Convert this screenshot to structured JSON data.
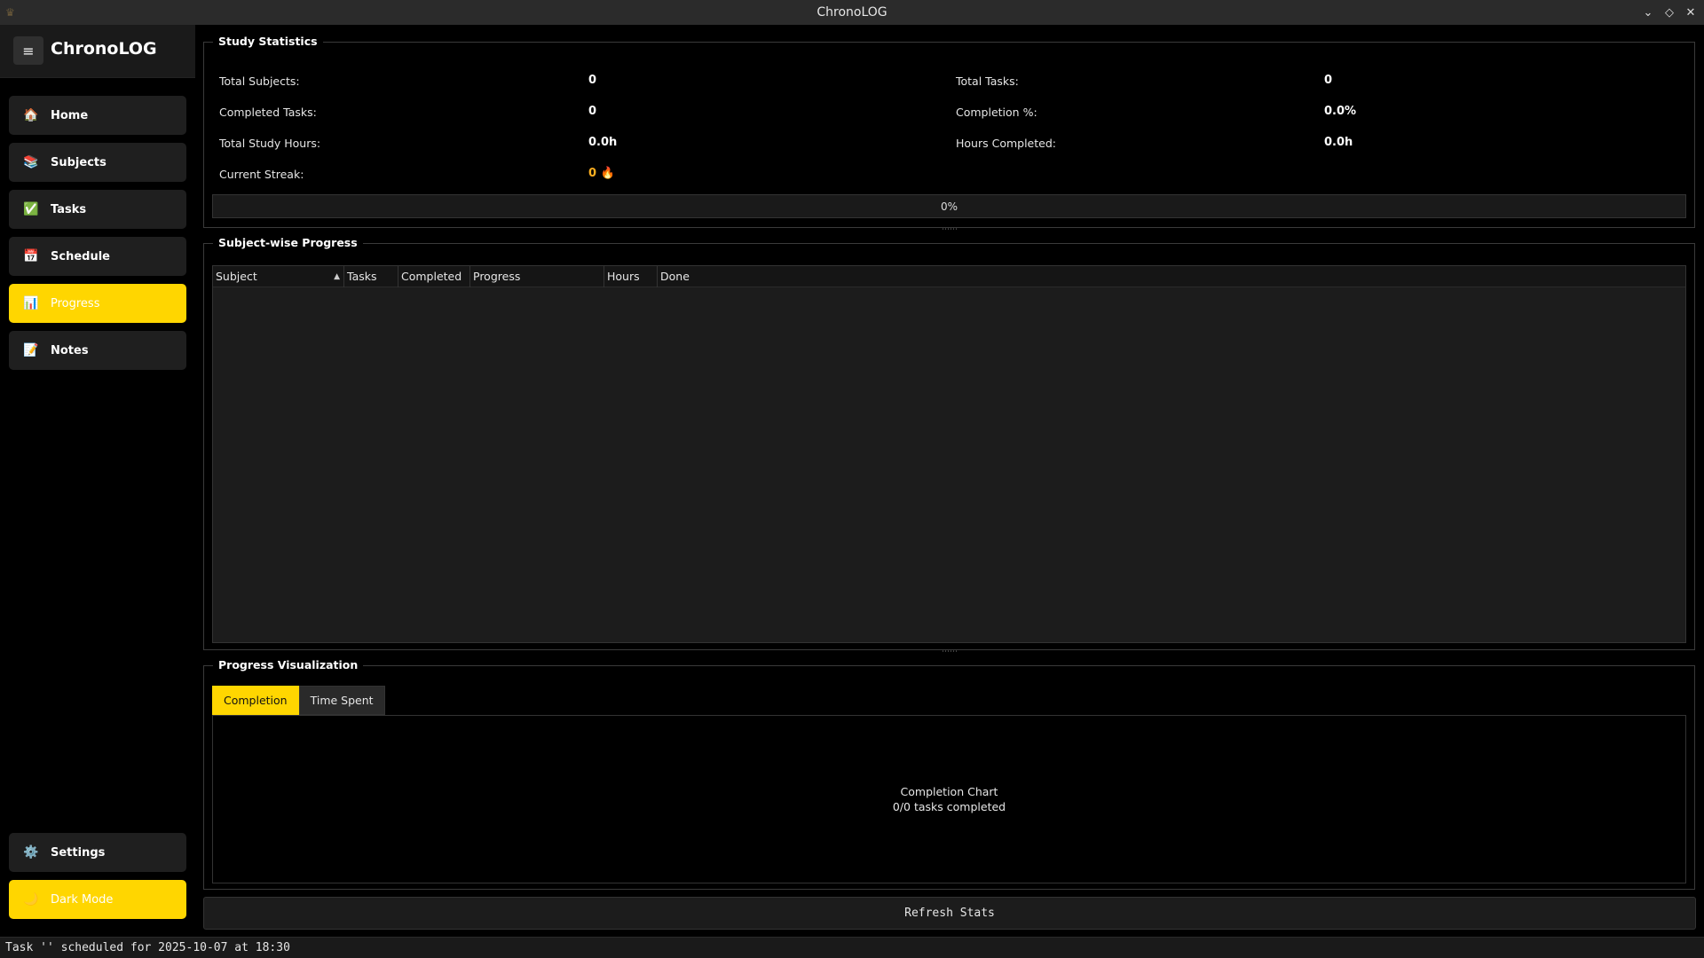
{
  "window": {
    "title": "ChronoLOG",
    "app_icon": "app-icon",
    "controls": {
      "minimize": "chevron-down-icon",
      "maximize": "diamond-icon",
      "close": "close-icon"
    }
  },
  "sidebar": {
    "brand": "ChronoLOG",
    "menu_icon": "≡",
    "items": [
      {
        "label": "Home",
        "icon": "🏠",
        "icon_name": "home-icon",
        "active": false
      },
      {
        "label": "Subjects",
        "icon": "📚",
        "icon_name": "books-icon",
        "active": false
      },
      {
        "label": "Tasks",
        "icon": "✅",
        "icon_name": "check-icon",
        "active": false
      },
      {
        "label": "Schedule",
        "icon": "📅",
        "icon_name": "calendar-icon",
        "active": false
      },
      {
        "label": "Progress",
        "icon": "📊",
        "icon_name": "chart-icon",
        "active": true
      },
      {
        "label": "Notes",
        "icon": "📝",
        "icon_name": "notes-icon",
        "active": false
      }
    ],
    "bottom": [
      {
        "label": "Settings",
        "icon": "⚙️",
        "icon_name": "gear-icon"
      },
      {
        "label": "Dark Mode",
        "icon": "🌙",
        "icon_name": "moon-icon"
      }
    ]
  },
  "stats": {
    "title": "Study Statistics",
    "total_subjects_label": "Total Subjects:",
    "total_subjects_value": "0",
    "total_tasks_label": "Total Tasks:",
    "total_tasks_value": "0",
    "completed_tasks_label": "Completed Tasks:",
    "completed_tasks_value": "0",
    "completion_pct_label": "Completion %:",
    "completion_pct_value": "0.0%",
    "total_hours_label": "Total Study Hours:",
    "total_hours_value": "0.0h",
    "hours_completed_label": "Hours Completed:",
    "hours_completed_value": "0.0h",
    "streak_label": "Current Streak:",
    "streak_value": "0 🔥",
    "progress_text": "0%",
    "progress_fraction": 0
  },
  "subject_progress": {
    "title": "Subject-wise Progress",
    "columns": [
      "Subject",
      "Tasks",
      "Completed",
      "Progress",
      "Hours",
      "Done"
    ],
    "rows": []
  },
  "visualization": {
    "title": "Progress Visualization",
    "tabs": [
      {
        "label": "Completion",
        "active": true
      },
      {
        "label": "Time Spent",
        "active": false
      }
    ],
    "chart_title": "Completion Chart",
    "chart_subtitle": "0/0 tasks completed"
  },
  "actions": {
    "refresh_label": "Refresh Stats"
  },
  "statusbar": {
    "message": "Task '' scheduled for 2025-10-07 at 18:30"
  },
  "colors": {
    "accent": "#ffd600",
    "streak": "#ffb020",
    "background": "#000000"
  }
}
